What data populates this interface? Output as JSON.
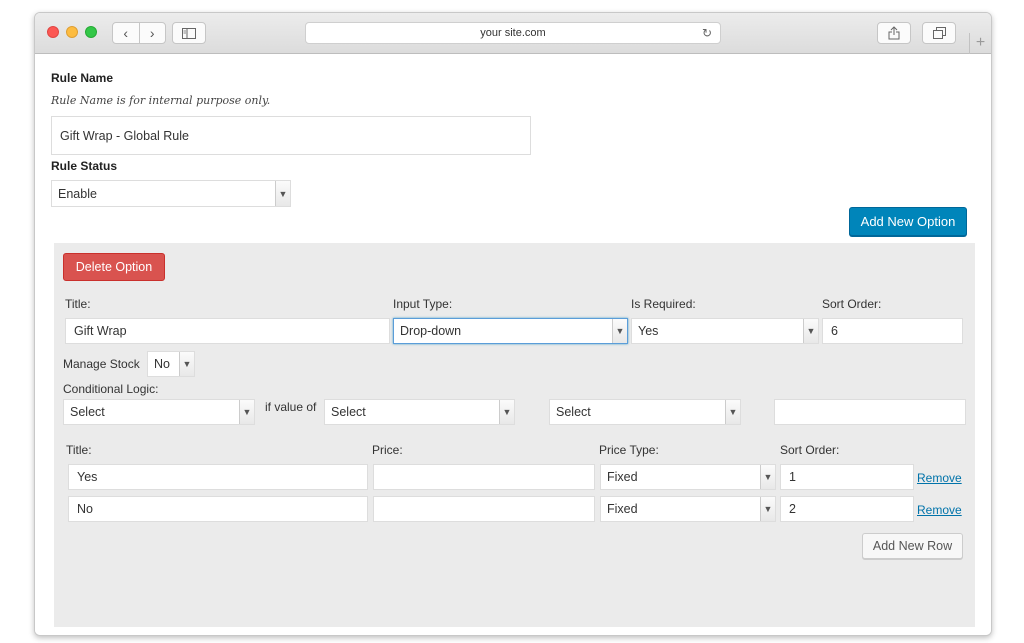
{
  "browser": {
    "address": "your site.com"
  },
  "rule": {
    "name_label": "Rule Name",
    "name_hint": "Rule Name is for internal purpose only.",
    "name_value": "Gift Wrap - Global Rule",
    "status_label": "Rule Status",
    "status_value": "Enable"
  },
  "add_option_label": "Add New Option",
  "option": {
    "delete_label": "Delete Option",
    "title_label": "Title:",
    "title_value": "Gift Wrap",
    "input_type_label": "Input Type:",
    "input_type_value": "Drop-down",
    "required_label": "Is Required:",
    "required_value": "Yes",
    "sort_label": "Sort Order:",
    "sort_value": "6",
    "manage_stock_label": "Manage Stock",
    "manage_stock_value": "No",
    "conditional_label": "Conditional Logic:",
    "cond_select_1": "Select",
    "if_value_label": "if value of",
    "cond_select_2": "Select",
    "cond_select_3": "Select",
    "cond_value": ""
  },
  "rows_header": {
    "title": "Title:",
    "price": "Price:",
    "price_type": "Price Type:",
    "sort": "Sort Order:"
  },
  "rows": [
    {
      "title": "Yes",
      "price": "",
      "price_type": "Fixed",
      "sort": "1",
      "remove": "Remove"
    },
    {
      "title": "No",
      "price": "",
      "price_type": "Fixed",
      "sort": "2",
      "remove": "Remove"
    }
  ],
  "add_row_label": "Add New Row"
}
